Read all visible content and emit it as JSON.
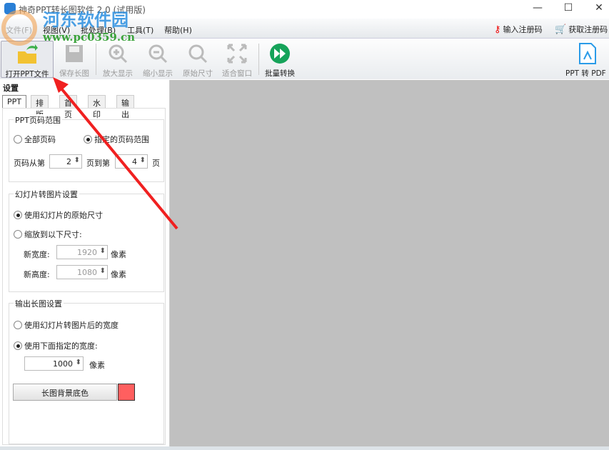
{
  "window": {
    "title": "神奇PPT转长图软件 2.0 (试用版)",
    "minimize": "—",
    "maximize": "☐",
    "close": "✕"
  },
  "watermark": {
    "name": "河东软件园",
    "url": "www.pc0359.cn"
  },
  "menu": [
    "文件(F)",
    "视图(V)",
    "批处理(B)",
    "工具(T)",
    "帮助(H)"
  ],
  "register": {
    "enter_code": "输入注册码",
    "get_code": "获取注册码"
  },
  "toolbar": {
    "open": "打开PPT文件",
    "save": "保存长图",
    "zoom_in": "放大显示",
    "zoom_out": "缩小显示",
    "original": "原始尺寸",
    "fit": "适合窗口",
    "batch": "批量转换",
    "to_pdf": "PPT 转 PDF"
  },
  "panel": {
    "title": "设置",
    "tabs": [
      "PPT",
      "排版",
      "首页",
      "水印",
      "输出"
    ]
  },
  "page_range": {
    "title": "PPT页码范围",
    "all": "全部页码",
    "specified": "指定的页码范围",
    "from_label": "页码从第",
    "from": "2",
    "to_label": "页到第",
    "to": "4",
    "suffix": "页"
  },
  "slide_image": {
    "title": "幻灯片转图片设置",
    "original": "使用幻灯片的原始尺寸",
    "scale": "缩放到以下尺寸:",
    "width_label": "新宽度:",
    "width": "1920",
    "height_label": "新高度:",
    "height": "1080",
    "unit": "像素"
  },
  "output": {
    "title": "输出长图设置",
    "use_slide": "使用幻灯片转图片后的宽度",
    "use_specified": "使用下面指定的宽度:",
    "width": "1000",
    "unit": "像素",
    "bg_button": "长图背景底色",
    "bg_color": "#ff5f5f"
  }
}
